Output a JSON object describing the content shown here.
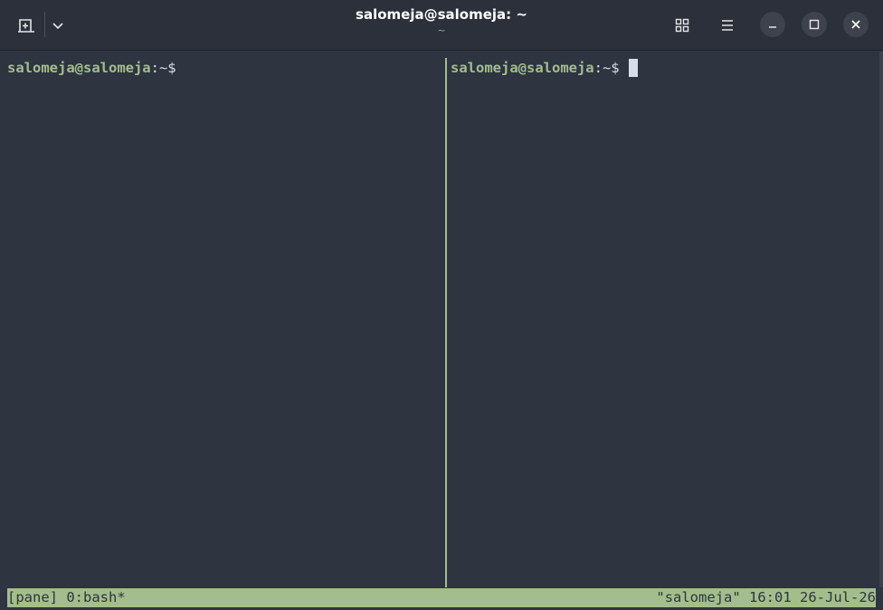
{
  "window": {
    "title": "salomeja@salomeja: ~",
    "subtitle": "~"
  },
  "icons": {
    "new_tab": "new-tab-icon",
    "dropdown": "chevron-down-icon",
    "tabs_overview": "grid-icon",
    "menu": "hamburger-icon",
    "minimize": "minimize-icon",
    "maximize": "maximize-icon",
    "close": "close-icon"
  },
  "panes": [
    {
      "user_host": "salomeja@salomeja",
      "path": ":~$",
      "active": false
    },
    {
      "user_host": "salomeja@salomeja",
      "path": ":~$ ",
      "active": true
    }
  ],
  "statusbar": {
    "left": "[pane] 0:bash*",
    "right": "\"salomeja\" 16:01 26-Jul-26"
  },
  "colors": {
    "background": "#2e3440",
    "prompt": "#a3be8c",
    "foreground": "#d8dee9",
    "statusbar": "#a3be8c"
  }
}
